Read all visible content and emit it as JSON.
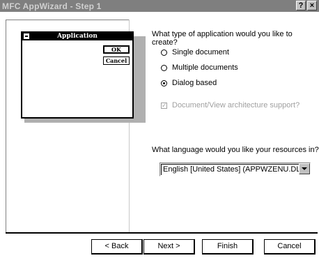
{
  "window": {
    "title": "MFC AppWizard - Step 1",
    "help_button": "?",
    "close_button": "×"
  },
  "preview": {
    "title": "Application",
    "ok_label": "OK",
    "cancel_label": "Cancel"
  },
  "app_type": {
    "question": "What type of application would you like to create?",
    "options": [
      {
        "label": "Single document",
        "selected": false
      },
      {
        "label": "Multiple documents",
        "selected": false
      },
      {
        "label": "Dialog based",
        "selected": true
      }
    ],
    "docview_label": "Document/View architecture support?",
    "docview_checked": true,
    "docview_enabled": false
  },
  "language": {
    "question": "What language would you like your resources in?",
    "selected": "English [United States] (APPWZENU.DLL"
  },
  "buttons": {
    "back": "< Back",
    "next": "Next >",
    "finish": "Finish",
    "cancel": "Cancel"
  }
}
